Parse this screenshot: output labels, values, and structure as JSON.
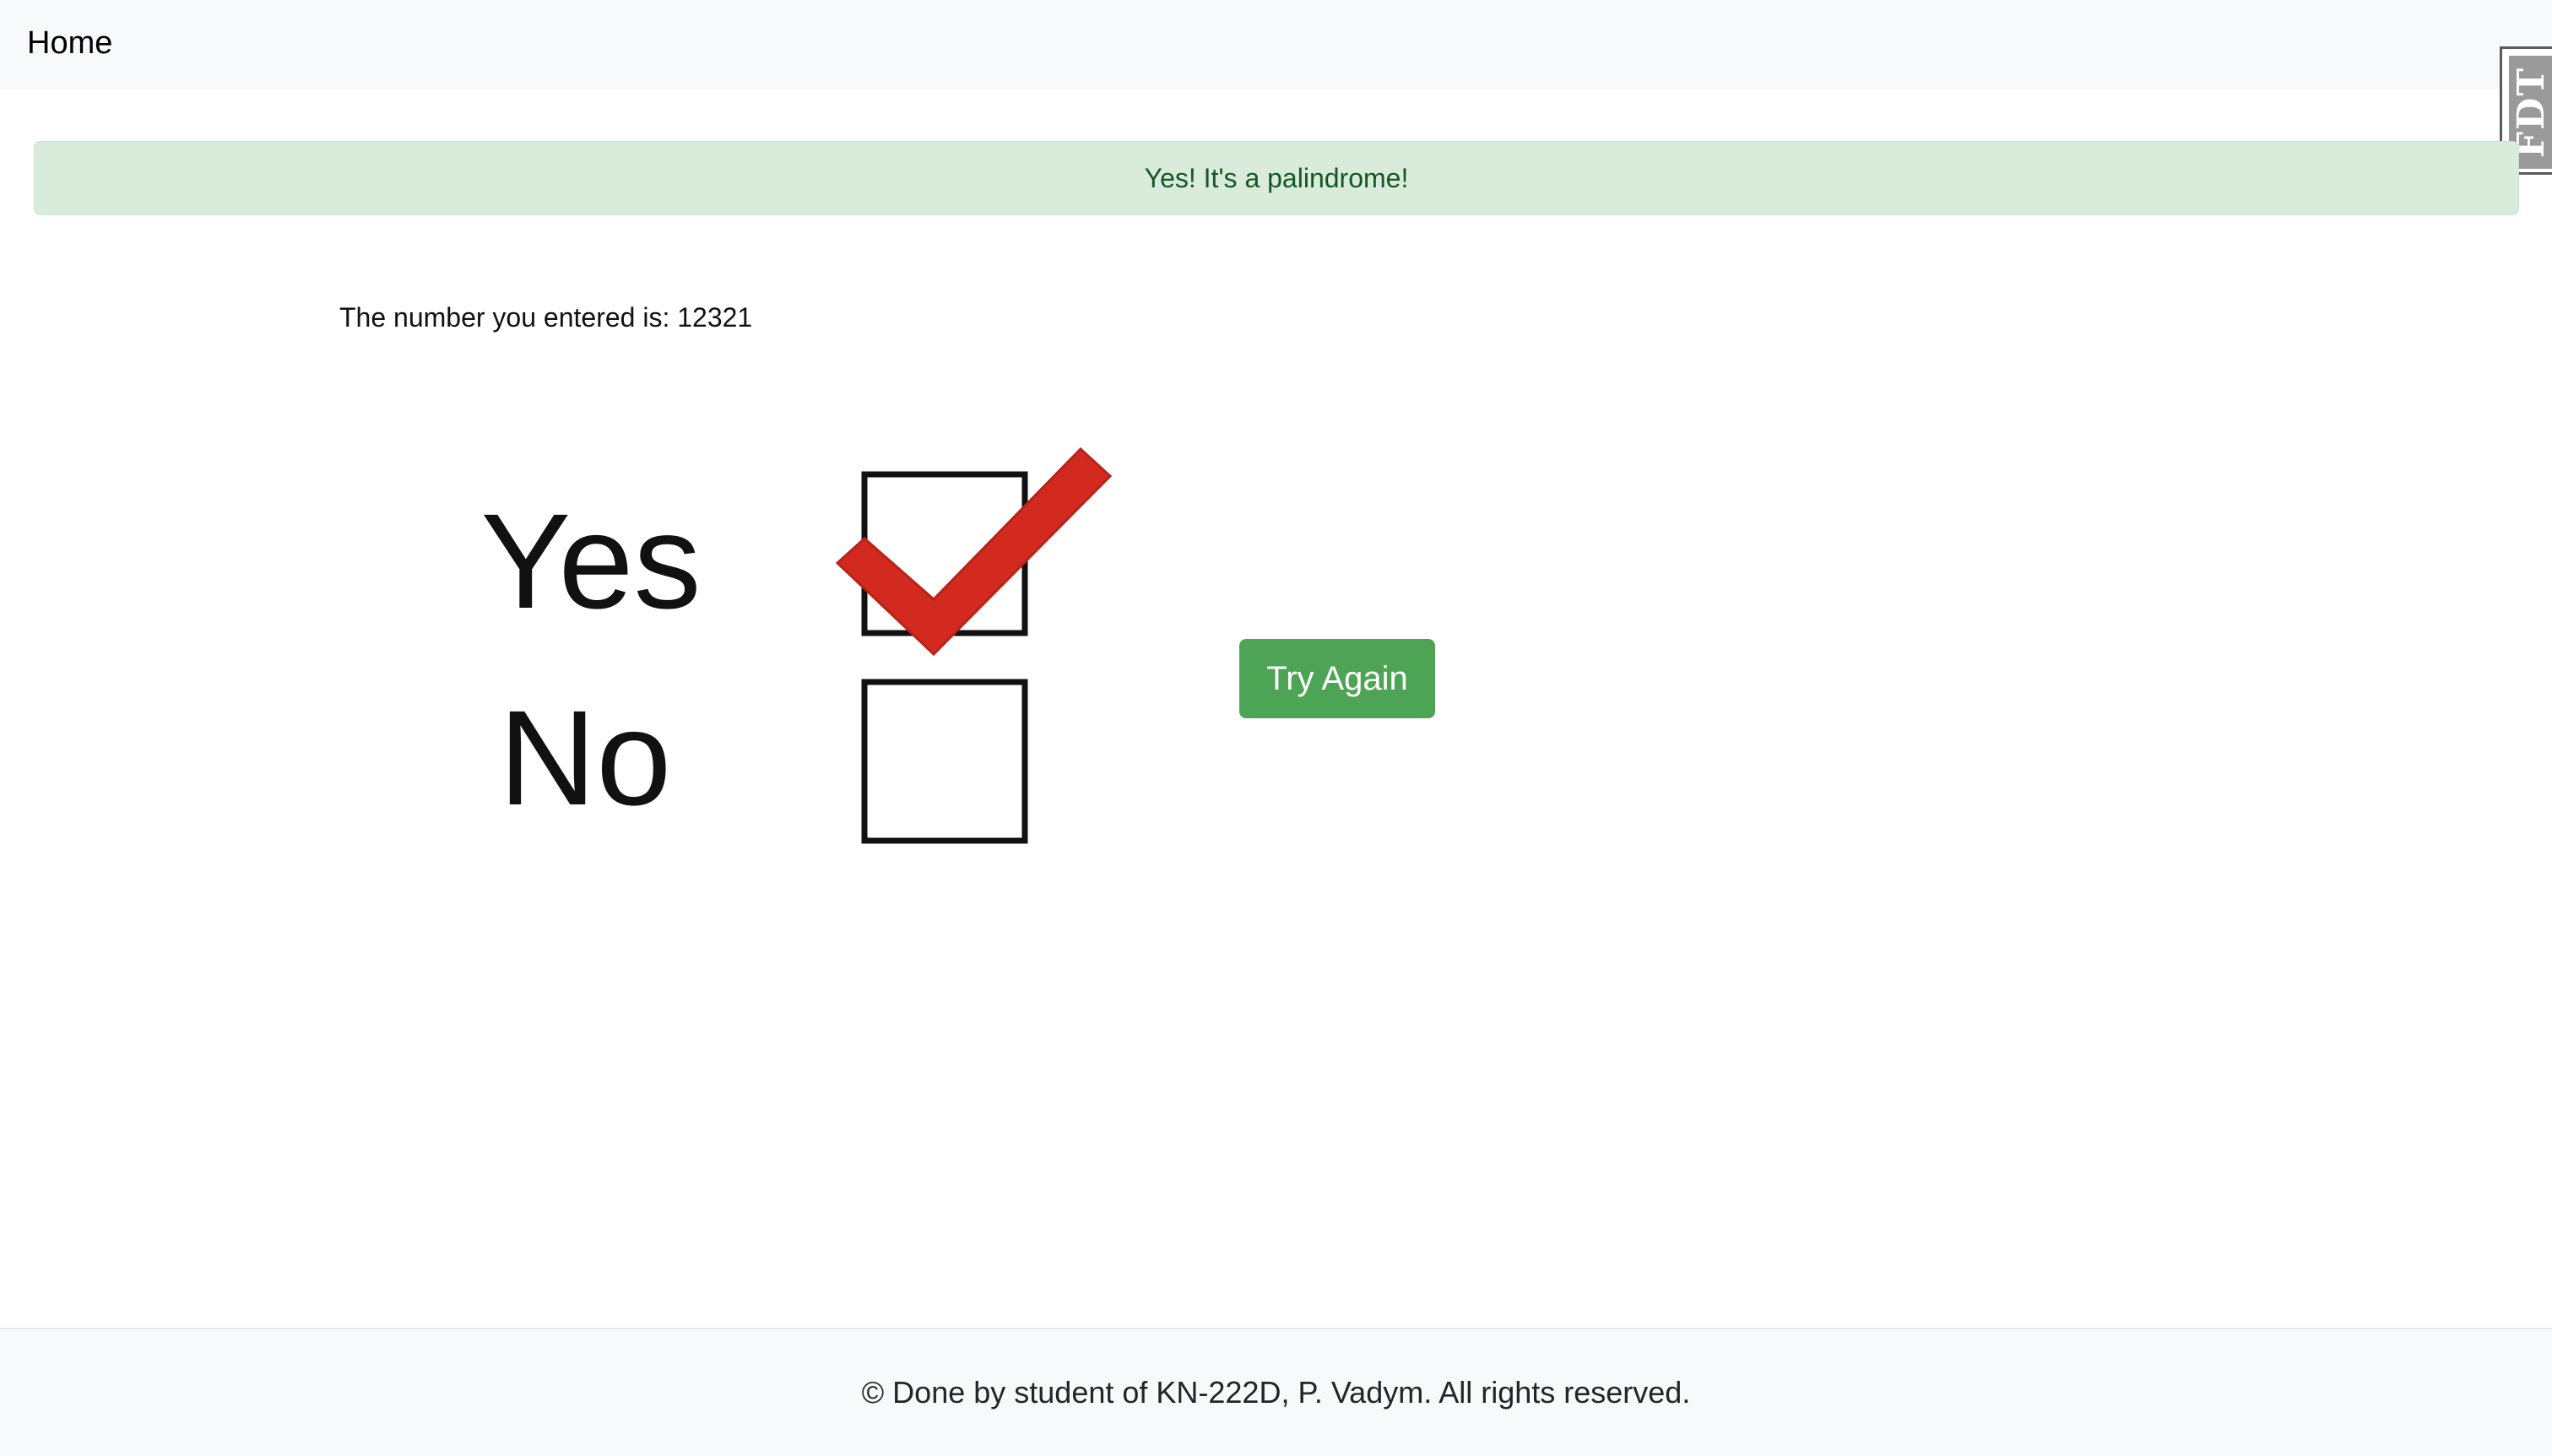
{
  "nav": {
    "home_label": "Home"
  },
  "extension_badge": {
    "text": "FDT"
  },
  "alert": {
    "message": "Yes! It's a palindrome!",
    "color": "#155724",
    "background": "#d9ecdc"
  },
  "result": {
    "label": "The number you entered is:",
    "value": "12321"
  },
  "illustration": {
    "yes_label": "Yes",
    "no_label": "No",
    "checked_option": "Yes",
    "check_color": "#d32a1f"
  },
  "actions": {
    "try_again_label": "Try Again",
    "button_color": "#4ea455"
  },
  "footer": {
    "text": "© Done by student of KN-222D, P. Vadym. All rights reserved."
  }
}
